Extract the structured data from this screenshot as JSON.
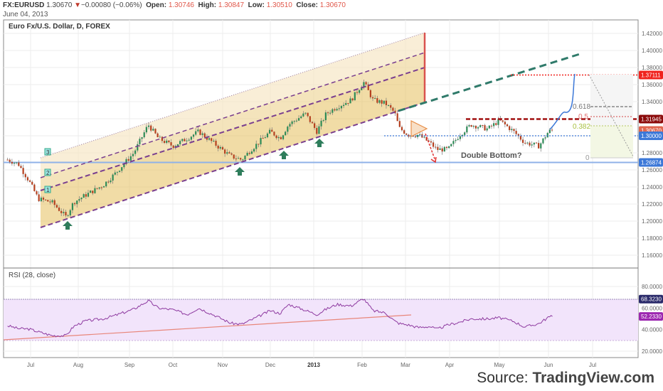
{
  "header": {
    "symbol": "FX:EURUSD",
    "last": "1.30670",
    "change": "−0.00080 (−0.06%)",
    "change_icon": "down-triangle-icon",
    "open_label": "Open:",
    "open": "1.30746",
    "high_label": "High:",
    "high": "1.30847",
    "low_label": "Low:",
    "low": "1.30510",
    "close_label": "Close:",
    "close": "1.30670",
    "date": "June 04, 2013"
  },
  "source": {
    "prefix": "Source: ",
    "brand": "TradingView.com"
  },
  "chart_data": [
    {
      "type": "candlestick",
      "title": "Euro Fx/U.S. Dollar, D, FOREX",
      "x_tick_labels": [
        "Jul",
        "Aug",
        "Sep",
        "Oct",
        "Nov",
        "Dec",
        "2013",
        "Feb",
        "Mar",
        "Apr",
        "May",
        "Jun",
        "Jul"
      ],
      "y_tick_labels": [
        "1.42000",
        "1.40000",
        "1.38000",
        "1.36000",
        "1.34000",
        "1.32000",
        "1.30000",
        "1.28000",
        "1.26000",
        "1.24000",
        "1.22000",
        "1.20000",
        "1.18000",
        "1.16000"
      ],
      "ylim": [
        1.15,
        1.43
      ],
      "grid": true,
      "close_series": [
        [
          "2012-06-16",
          1.272
        ],
        [
          "2012-06-23",
          1.267
        ],
        [
          "2012-06-30",
          1.247
        ],
        [
          "2012-07-06",
          1.226
        ],
        [
          "2012-07-15",
          1.222
        ],
        [
          "2012-07-24",
          1.205
        ],
        [
          "2012-07-29",
          1.222
        ],
        [
          "2012-08-05",
          1.23
        ],
        [
          "2012-08-16",
          1.242
        ],
        [
          "2012-08-23",
          1.255
        ],
        [
          "2012-09-04",
          1.28
        ],
        [
          "2012-09-14",
          1.313
        ],
        [
          "2012-09-21",
          1.297
        ],
        [
          "2012-10-01",
          1.288
        ],
        [
          "2012-10-10",
          1.297
        ],
        [
          "2012-10-17",
          1.305
        ],
        [
          "2012-10-26",
          1.292
        ],
        [
          "2012-11-06",
          1.276
        ],
        [
          "2012-11-13",
          1.272
        ],
        [
          "2012-11-19",
          1.284
        ],
        [
          "2012-12-01",
          1.305
        ],
        [
          "2012-12-08",
          1.297
        ],
        [
          "2012-12-14",
          1.313
        ],
        [
          "2012-12-26",
          1.326
        ],
        [
          "2013-01-03",
          1.305
        ],
        [
          "2013-01-09",
          1.326
        ],
        [
          "2013-01-16",
          1.334
        ],
        [
          "2013-01-25",
          1.342
        ],
        [
          "2013-02-02",
          1.363
        ],
        [
          "2013-02-08",
          1.342
        ],
        [
          "2013-02-16",
          1.338
        ],
        [
          "2013-02-22",
          1.327
        ],
        [
          "2013-02-25",
          1.309
        ],
        [
          "2013-03-03",
          1.301
        ],
        [
          "2013-03-10",
          1.301
        ],
        [
          "2013-03-18",
          1.292
        ],
        [
          "2013-03-23",
          1.284
        ],
        [
          "2013-03-31",
          1.284
        ],
        [
          "2013-04-07",
          1.301
        ],
        [
          "2013-04-14",
          1.313
        ],
        [
          "2013-04-24",
          1.308
        ],
        [
          "2013-05-01",
          1.318
        ],
        [
          "2013-05-10",
          1.305
        ],
        [
          "2013-05-17",
          1.292
        ],
        [
          "2013-05-26",
          1.288
        ],
        [
          "2013-06-01",
          1.305
        ],
        [
          "2013-06-04",
          1.3067
        ]
      ],
      "price_labels": [
        {
          "value": "1.37111",
          "color": "#f0231e"
        },
        {
          "value": "1.31945",
          "color": "#8b0a0a"
        },
        {
          "value": "1.30670",
          "color": "#e0664f"
        },
        {
          "value": "1.30000",
          "color": "#3c78d8"
        },
        {
          "value": "1.26874",
          "color": "#3c78d8"
        }
      ],
      "channel_labels": [
        "1",
        "2",
        "3"
      ],
      "fib_levels": [
        "0.618",
        "0.5",
        "0.382",
        "0"
      ],
      "annotation": "Double Bottom?",
      "colors": {
        "up": "#2e8b57",
        "down": "#b5401f",
        "channel": "#7a3f8f",
        "fill": "#e8c46a",
        "trend_ext": "#2f7a6a",
        "arrow": "#2e7d5b"
      }
    },
    {
      "type": "line",
      "title": "RSI (28, close)",
      "y_tick_labels": [
        "80.0000",
        "60.0000",
        "40.0000",
        "20.0000"
      ],
      "ylim": [
        14,
        92
      ],
      "bands": [
        30,
        70
      ],
      "series": [
        {
          "values": [
            43.7,
            41,
            40.6,
            38,
            34.5,
            34.5,
            43,
            48,
            50,
            53,
            59,
            66.8,
            60,
            58.5,
            54,
            60,
            54,
            46,
            45,
            49,
            57.6,
            55,
            63.5,
            58,
            54,
            59,
            63.5,
            62,
            68.8,
            57.6,
            55.6,
            48,
            45.7,
            44.4,
            42,
            43,
            40.4,
            44.4,
            47,
            50,
            50,
            51,
            47.7,
            42.4,
            45.7,
            51.6,
            52.2
          ]
        }
      ],
      "value_labels": [
        {
          "value": "68.3230",
          "color": "#2a2a6a"
        },
        {
          "value": "52.2330",
          "color": "#9c27b0"
        }
      ],
      "colors": {
        "line": "#8e3aa0",
        "band": "#f2e4fb",
        "trend": "#e8867a"
      }
    }
  ]
}
